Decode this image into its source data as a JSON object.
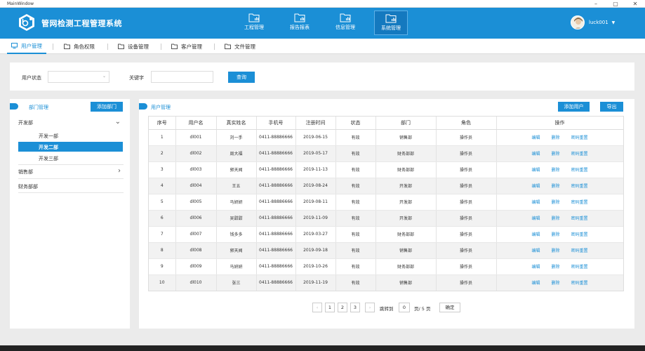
{
  "window": {
    "title": "MainWindow",
    "min": "–",
    "max": "▢",
    "close": "✕"
  },
  "app": {
    "title": "管网检测工程管理系统"
  },
  "nav": [
    {
      "label": "工程管理"
    },
    {
      "label": "报告报表"
    },
    {
      "label": "信息管理"
    },
    {
      "label": "系统管理"
    }
  ],
  "user": {
    "name": "luck001",
    "caret": "▼"
  },
  "tabs": [
    {
      "label": "用户管理"
    },
    {
      "label": "角色权限"
    },
    {
      "label": "设备管理"
    },
    {
      "label": "客户管理"
    },
    {
      "label": "文件管理"
    }
  ],
  "filter": {
    "status_label": "用户状态",
    "status_arrow": "⌄",
    "keyword_label": "关键字",
    "search_label": "查询"
  },
  "dept": {
    "title": "部门管理",
    "add_label": "添加部门",
    "tree": [
      {
        "label": "开发部",
        "arrow": "⌄"
      },
      {
        "label": "开发一部"
      },
      {
        "label": "开发二部"
      },
      {
        "label": "开发三部"
      },
      {
        "label": "销售部",
        "arrow": "›"
      },
      {
        "label": "财务部部"
      }
    ]
  },
  "users": {
    "title": "用户管理",
    "add_label": "添加用户",
    "export_label": "导出",
    "columns": [
      "序号",
      "用户名",
      "真实姓名",
      "手机号",
      "注册时间",
      "状态",
      "部门",
      "角色",
      "操作"
    ],
    "actions": [
      "编辑",
      "删除",
      "密码重置"
    ],
    "rows": [
      [
        "1",
        "dl001",
        "刘一手",
        "0411-88886666",
        "2019-06-15",
        "有效",
        "销售部",
        "操作员"
      ],
      [
        "2",
        "dl002",
        "周大福",
        "0411-88886666",
        "2019-05-17",
        "有效",
        "财务部部",
        "操作员"
      ],
      [
        "3",
        "dl003",
        "郭天闻",
        "0411-88886666",
        "2019-11-13",
        "有效",
        "财务部部",
        "操作员"
      ],
      [
        "4",
        "dl004",
        "王五",
        "0411-88886666",
        "2019-08-24",
        "有效",
        "开发部",
        "操作员"
      ],
      [
        "5",
        "dl005",
        "马妍妍",
        "0411-88886666",
        "2019-08-11",
        "有效",
        "开发部",
        "操作员"
      ],
      [
        "6",
        "dl006",
        "吴甜甜",
        "0411-88886666",
        "2019-11-09",
        "有效",
        "开发部",
        "操作员"
      ],
      [
        "7",
        "dl007",
        "钱多多",
        "0411-88886666",
        "2019-03-27",
        "有效",
        "财务部部",
        "操作员"
      ],
      [
        "8",
        "dl008",
        "郭天闻",
        "0411-88886666",
        "2019-09-18",
        "有效",
        "销售部",
        "操作员"
      ],
      [
        "9",
        "dl009",
        "马妍妍",
        "0411-88886666",
        "2019-10-26",
        "有效",
        "财务部部",
        "操作员"
      ],
      [
        "10",
        "dl010",
        "张三",
        "0411-88886666",
        "2019-11-19",
        "有效",
        "销售部",
        "操作员"
      ]
    ]
  },
  "pager": {
    "prev": "‹",
    "pages": [
      "1",
      "2",
      "3"
    ],
    "next": "›",
    "goto_label": "跳转到",
    "goto_value": "0",
    "total_label": "页/ 5 页",
    "confirm_label": "确定"
  },
  "colors": {
    "primary": "#1b8fd6",
    "active_nav": "#1479bf"
  }
}
